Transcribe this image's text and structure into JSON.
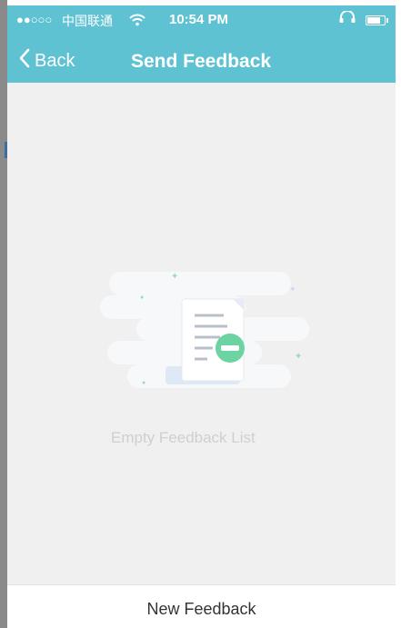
{
  "status_bar": {
    "signal": "●●○○○",
    "carrier": "中国联通",
    "time": "10:54 PM"
  },
  "nav": {
    "back_label": "Back",
    "title": "Send Feedback"
  },
  "empty_state": {
    "message": "Empty Feedback List"
  },
  "footer": {
    "new_feedback_label": "New Feedback"
  },
  "colors": {
    "nav_bar": "#5fc2d3",
    "accent_green": "#6ed3a3",
    "background": "#f0f0f0"
  },
  "icons": [
    "wifi-icon",
    "headphones-icon",
    "battery-icon",
    "back-chevron-icon",
    "empty-document-icon"
  ]
}
